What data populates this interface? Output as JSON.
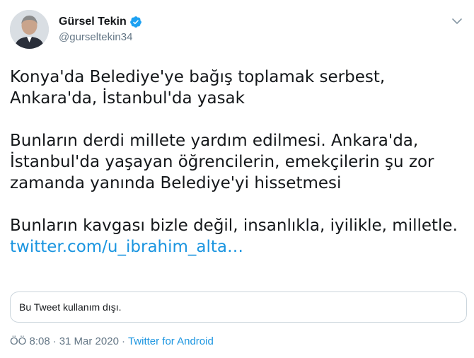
{
  "author": {
    "name": "Gürsel Tekin",
    "handle": "@gurseltekin34",
    "avatar_icon": "avatar",
    "verified_icon": "verified-badge-icon",
    "verified_color": "#1da1f2"
  },
  "tweet": {
    "paragraphs": [
      [
        "Konya'da Belediye'ye bağış toplamak serbest,",
        "Ankara'da, İstanbul'da yasak"
      ],
      [
        "Bunların derdi millete yardım edilmesi. Ankara'da,",
        "İstanbul'da yaşayan öğrencilerin, emekçilerin şu zor",
        "zamanda yanında Belediye'yi hissetmesi"
      ],
      [
        "Bunların kavgası bizle değil, insanlıkla, iyilikle, milletle."
      ]
    ],
    "link_text": "twitter.com/u_ibrahim_alta…",
    "link_color": "#1b95e0"
  },
  "quoted_card": {
    "text": "Bu Tweet kullanım dışı."
  },
  "meta": {
    "time": "ÖÖ 8:08",
    "separator": "·",
    "date": "31 Mar 2020",
    "source": "Twitter for Android"
  },
  "menu_icon": "chevron-down-icon"
}
